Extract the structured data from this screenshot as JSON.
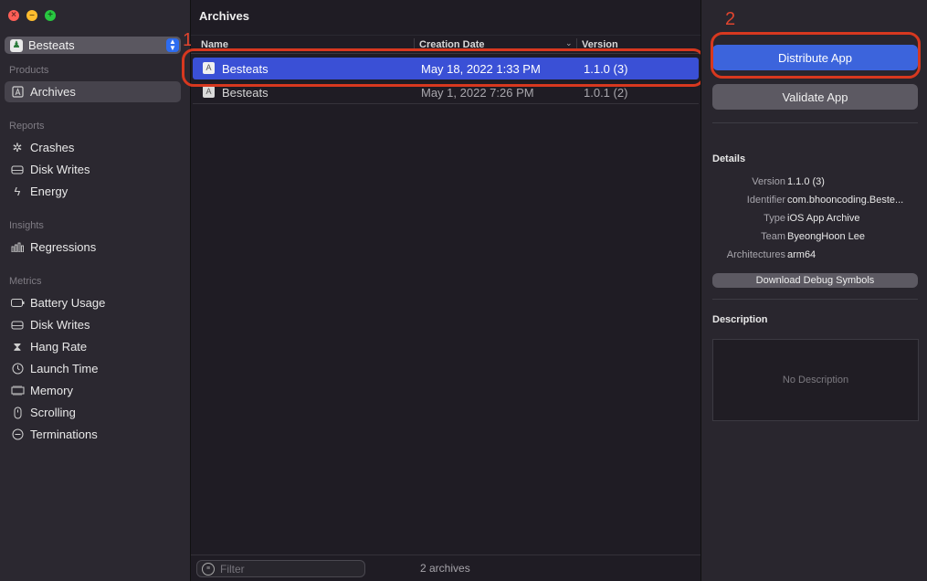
{
  "sidebar": {
    "app_name": "Besteats",
    "sections": {
      "products": "Products",
      "reports": "Reports",
      "insights": "Insights",
      "metrics": "Metrics"
    },
    "items": {
      "archives": "Archives",
      "crashes": "Crashes",
      "disk_writes_reports": "Disk Writes",
      "energy": "Energy",
      "regressions": "Regressions",
      "battery_usage": "Battery Usage",
      "disk_writes_metrics": "Disk Writes",
      "hang_rate": "Hang Rate",
      "launch_time": "Launch Time",
      "memory": "Memory",
      "scrolling": "Scrolling",
      "terminations": "Terminations"
    }
  },
  "annotations": {
    "step1": "1",
    "step2": "2"
  },
  "archives": {
    "title": "Archives",
    "columns": {
      "name": "Name",
      "creation_date": "Creation Date",
      "version": "Version"
    },
    "rows": [
      {
        "name": "Besteats",
        "date": "May 18, 2022 1:33 PM",
        "version": "1.1.0 (3)"
      },
      {
        "name": "Besteats",
        "date": "May 1, 2022 7:26 PM",
        "version": "1.0.1 (2)"
      }
    ],
    "filter_placeholder": "Filter",
    "count": "2 archives"
  },
  "inspector": {
    "distribute": "Distribute App",
    "validate": "Validate App",
    "details_heading": "Details",
    "details": {
      "version_key": "Version",
      "version": "1.1.0 (3)",
      "identifier_key": "Identifier",
      "identifier": "com.bhooncoding.Beste...",
      "type_key": "Type",
      "type": "iOS App Archive",
      "team_key": "Team",
      "team": "ByeongHoon Lee",
      "arch_key": "Architectures",
      "arch": "arm64"
    },
    "download_debug": "Download Debug Symbols",
    "description_heading": "Description",
    "description_placeholder": "No Description"
  },
  "colors": {
    "accent": "#3c64dc",
    "selection": "#3a50d6",
    "annotation": "#d7381f"
  }
}
